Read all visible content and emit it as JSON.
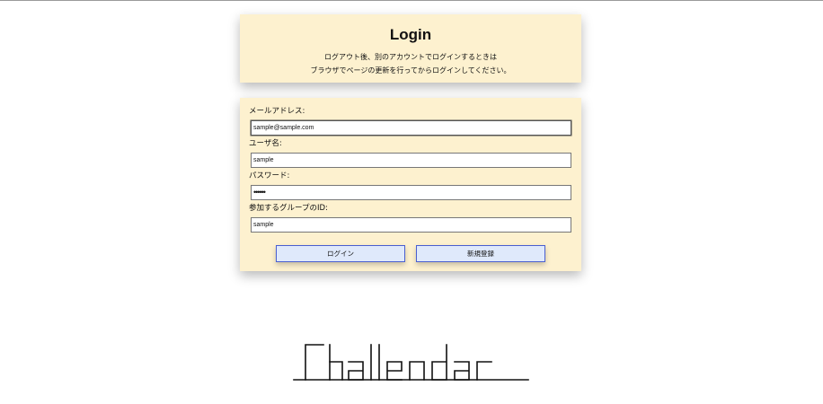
{
  "header": {
    "title": "Login",
    "notes": [
      "ログアウト後、別のアカウントでログインするときは",
      "ブラウザでページの更新を行ってからログインしてください。"
    ]
  },
  "form": {
    "email": {
      "label": "メールアドレス:",
      "value": "sample@sample.com"
    },
    "username": {
      "label": "ユーザ名:",
      "value": "sample"
    },
    "password": {
      "label": "パスワード:",
      "value": "••••••"
    },
    "group_id": {
      "label": "参加するグループのID:",
      "value": "sample"
    },
    "buttons": {
      "login": "ログイン",
      "register": "新規登録"
    }
  },
  "logo": {
    "text": "Challendar"
  },
  "colors": {
    "card_background": "#fdf1cf",
    "button_background": "#dfe9fb",
    "button_border": "#4a5fd0"
  }
}
